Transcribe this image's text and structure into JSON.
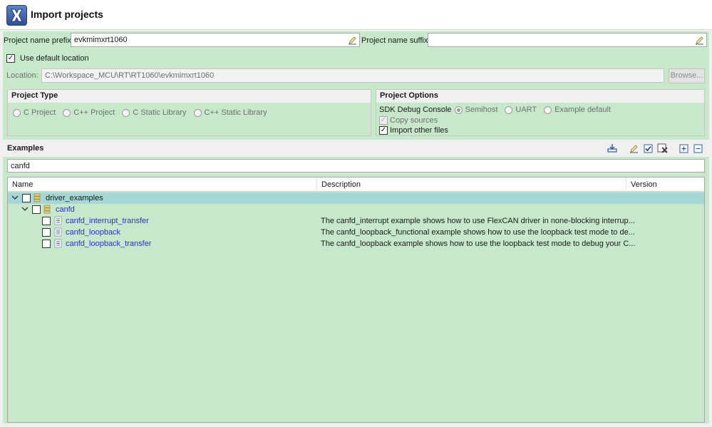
{
  "header": {
    "title": "Import projects"
  },
  "form": {
    "prefix_label": "Project name prefix:",
    "prefix_value": "evkmimxrt1060",
    "suffix_label": "Project name suffix:",
    "suffix_value": "",
    "use_default_location_label": "Use default location",
    "use_default_location_checked": true,
    "location_label": "Location:",
    "location_value": "C:\\Workspace_MCU\\RT\\RT1060\\evkmimxrt1060",
    "browse_label": "Browse..."
  },
  "project_type": {
    "title": "Project Type",
    "options": [
      "C Project",
      "C++ Project",
      "C Static Library",
      "C++ Static Library"
    ]
  },
  "project_options": {
    "title": "Project Options",
    "sdk_debug_console_label": "SDK Debug Console",
    "console_options": [
      "Semihost",
      "UART",
      "Example default"
    ],
    "copy_sources_label": "Copy sources",
    "import_other_files_label": "Import other files"
  },
  "examples": {
    "title": "Examples",
    "filter_value": "canfd",
    "columns": [
      "Name",
      "Description",
      "Version"
    ],
    "rows": [
      {
        "name": "driver_examples",
        "description": "",
        "version": ""
      },
      {
        "name": "canfd",
        "description": "",
        "version": ""
      },
      {
        "name": "canfd_interrupt_transfer",
        "description": "The canfd_interrupt example shows how to use FlexCAN driver in none-blocking interrup...",
        "version": ""
      },
      {
        "name": "canfd_loopback",
        "description": "The canfd_loopback_functional example shows how to use the loopback test mode to de...",
        "version": ""
      },
      {
        "name": "canfd_loopback_transfer",
        "description": "The canfd_loopback example shows how to use the loopback test mode to debug your C...",
        "version": ""
      }
    ]
  },
  "colors": {
    "panel_green": "#c7e8cb",
    "selected_row": "#a4d7d5",
    "link_blue": "#2d2fcc"
  }
}
